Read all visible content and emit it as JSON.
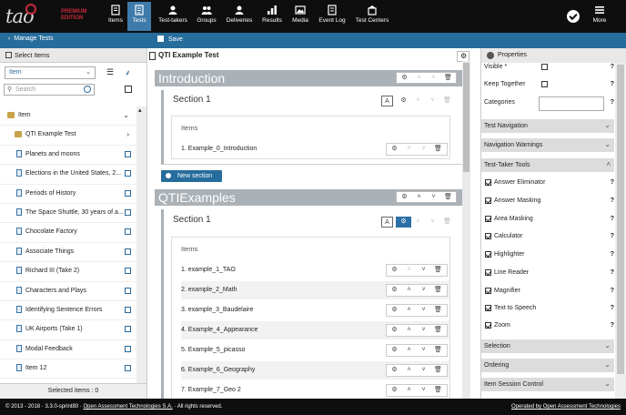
{
  "brand": {
    "logo": "tao",
    "edition_line1": "PREMIUM",
    "edition_line2": "EDITION",
    "accent": "#c82a3b"
  },
  "nav": [
    {
      "label": "Items",
      "icon": "items-icon"
    },
    {
      "label": "Tests",
      "icon": "tests-icon",
      "active": true
    },
    {
      "label": "Test-takers",
      "icon": "test-takers-icon"
    },
    {
      "label": "Groups",
      "icon": "groups-icon"
    },
    {
      "label": "Deliveries",
      "icon": "deliveries-icon"
    },
    {
      "label": "Results",
      "icon": "results-icon"
    },
    {
      "label": "Media",
      "icon": "media-icon"
    },
    {
      "label": "Event Log",
      "icon": "event-log-icon"
    },
    {
      "label": "Test Centers",
      "icon": "test-centers-icon"
    }
  ],
  "user_menu": {
    "more_label": "More"
  },
  "actionbar": {
    "manage_tests": "Manage Tests",
    "save": "Save"
  },
  "left": {
    "header": "Select Items",
    "select_value": "Item",
    "search_placeholder": "Search",
    "tree": [
      {
        "label": "Item",
        "type": "folder"
      },
      {
        "label": "QTI Example Test",
        "type": "subfolder"
      },
      {
        "label": "Planets and moons",
        "type": "item"
      },
      {
        "label": "Elections in the United States, 2...",
        "type": "item"
      },
      {
        "label": "Periods of History",
        "type": "item"
      },
      {
        "label": "The Space Shuttle, 30 years of a...",
        "type": "item"
      },
      {
        "label": "Chocolate Factory",
        "type": "item"
      },
      {
        "label": "Associate Things",
        "type": "item"
      },
      {
        "label": "Richard III (Take 2)",
        "type": "item"
      },
      {
        "label": "Characters and Plays",
        "type": "item"
      },
      {
        "label": "Identifying Sentence Errors",
        "type": "item"
      },
      {
        "label": "UK Airports (Take 1)",
        "type": "item"
      },
      {
        "label": "Modal Feedback",
        "type": "item"
      },
      {
        "label": "Item 12",
        "type": "item"
      }
    ],
    "selected_items": "Selected items : 0"
  },
  "center": {
    "title": "QTI Example Test",
    "testparts": [
      {
        "title": "Introduction",
        "section": "Section 1",
        "items_label": "Items",
        "items": [
          "1. Example_0_Introduction"
        ],
        "new_section": "New section"
      },
      {
        "title": "QTIExamples",
        "section": "Section 1",
        "items_label": "Items",
        "items": [
          "1. example_1_TAO",
          "2. example_2_Math",
          "3. example_3_Baudelaire",
          "4. Example_4_Appearance",
          "5. Example_5_picasso",
          "6. Example_6_Geography",
          "7. Example_7_Geo 2"
        ]
      }
    ]
  },
  "right": {
    "header": "Properties",
    "visible_label": "Visible *",
    "keep_together_label": "Keep Together",
    "categories_label": "Categories",
    "accordions": [
      "Test Navigation",
      "Navigation Warnings",
      "Test-Taker Tools",
      "Selection",
      "Ordering",
      "Item Session Control"
    ],
    "tools": [
      "Answer Eliminator",
      "Answer Masking",
      "Area Masking",
      "Calculator",
      "Highlighter",
      "Line Reader",
      "Magnifier",
      "Text to Speech",
      "Zoom"
    ]
  },
  "footer": {
    "copyright": "© 2013 - 2018 · 3.3.0-sprint80 · ",
    "company_link": "Open Assessment Technologies S.A.",
    "rights": " · All rights reserved.",
    "operated": "Operated by Open Assessment Technologies"
  }
}
